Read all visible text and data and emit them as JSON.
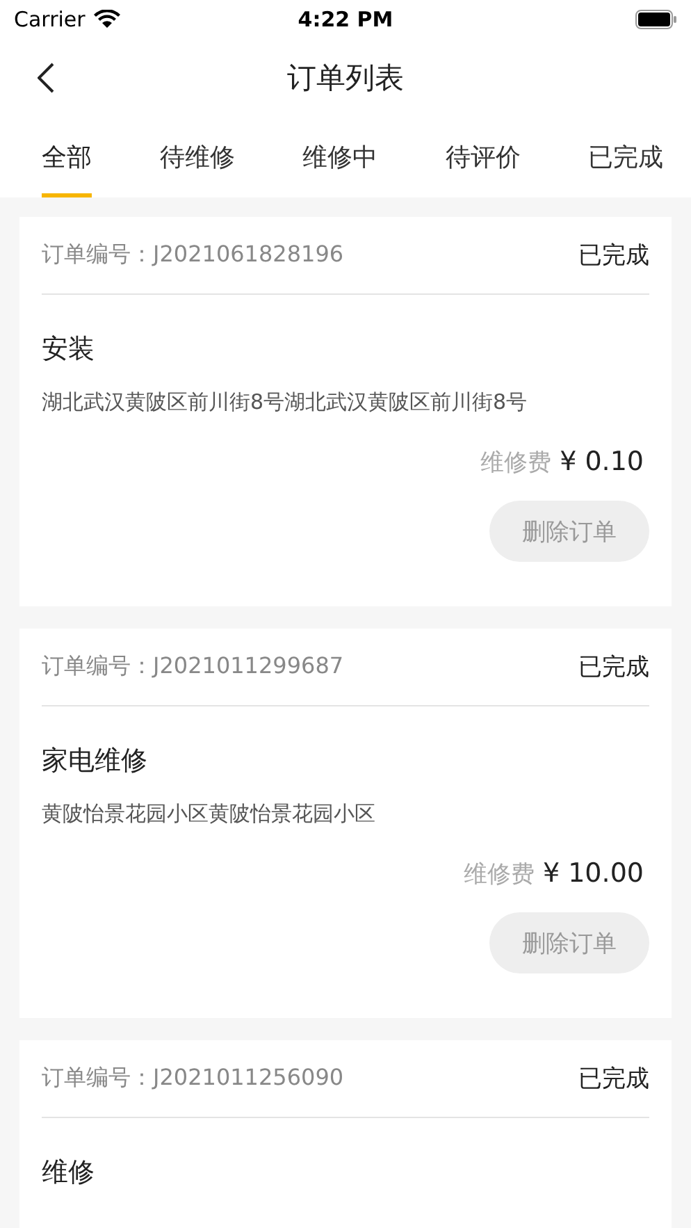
{
  "status_bar": {
    "carrier": "Carrier",
    "time": "4:22 PM"
  },
  "nav": {
    "title": "订单列表"
  },
  "tabs": [
    {
      "label": "全部",
      "selected": true
    },
    {
      "label": "待维修",
      "selected": false
    },
    {
      "label": "维修中",
      "selected": false
    },
    {
      "label": "待评价",
      "selected": false
    },
    {
      "label": "已完成",
      "selected": false
    }
  ],
  "orders": [
    {
      "number_label": "订单编号：",
      "number": "J2021061828196",
      "status": "已完成",
      "title": "安装",
      "address": "湖北武汉黄陂区前川街8号湖北武汉黄陂区前川街8号",
      "fee_label": "维修费",
      "fee": "¥ 0.10",
      "action": "删除订单"
    },
    {
      "number_label": "订单编号：",
      "number": "J2021011299687",
      "status": "已完成",
      "title": "家电维修",
      "address": "黄陂怡景花园小区黄陂怡景花园小区",
      "fee_label": "维修费",
      "fee": "¥ 10.00",
      "action": "删除订单"
    },
    {
      "number_label": "订单编号：",
      "number": "J2021011256090",
      "status": "已完成",
      "title": "维修"
    }
  ]
}
